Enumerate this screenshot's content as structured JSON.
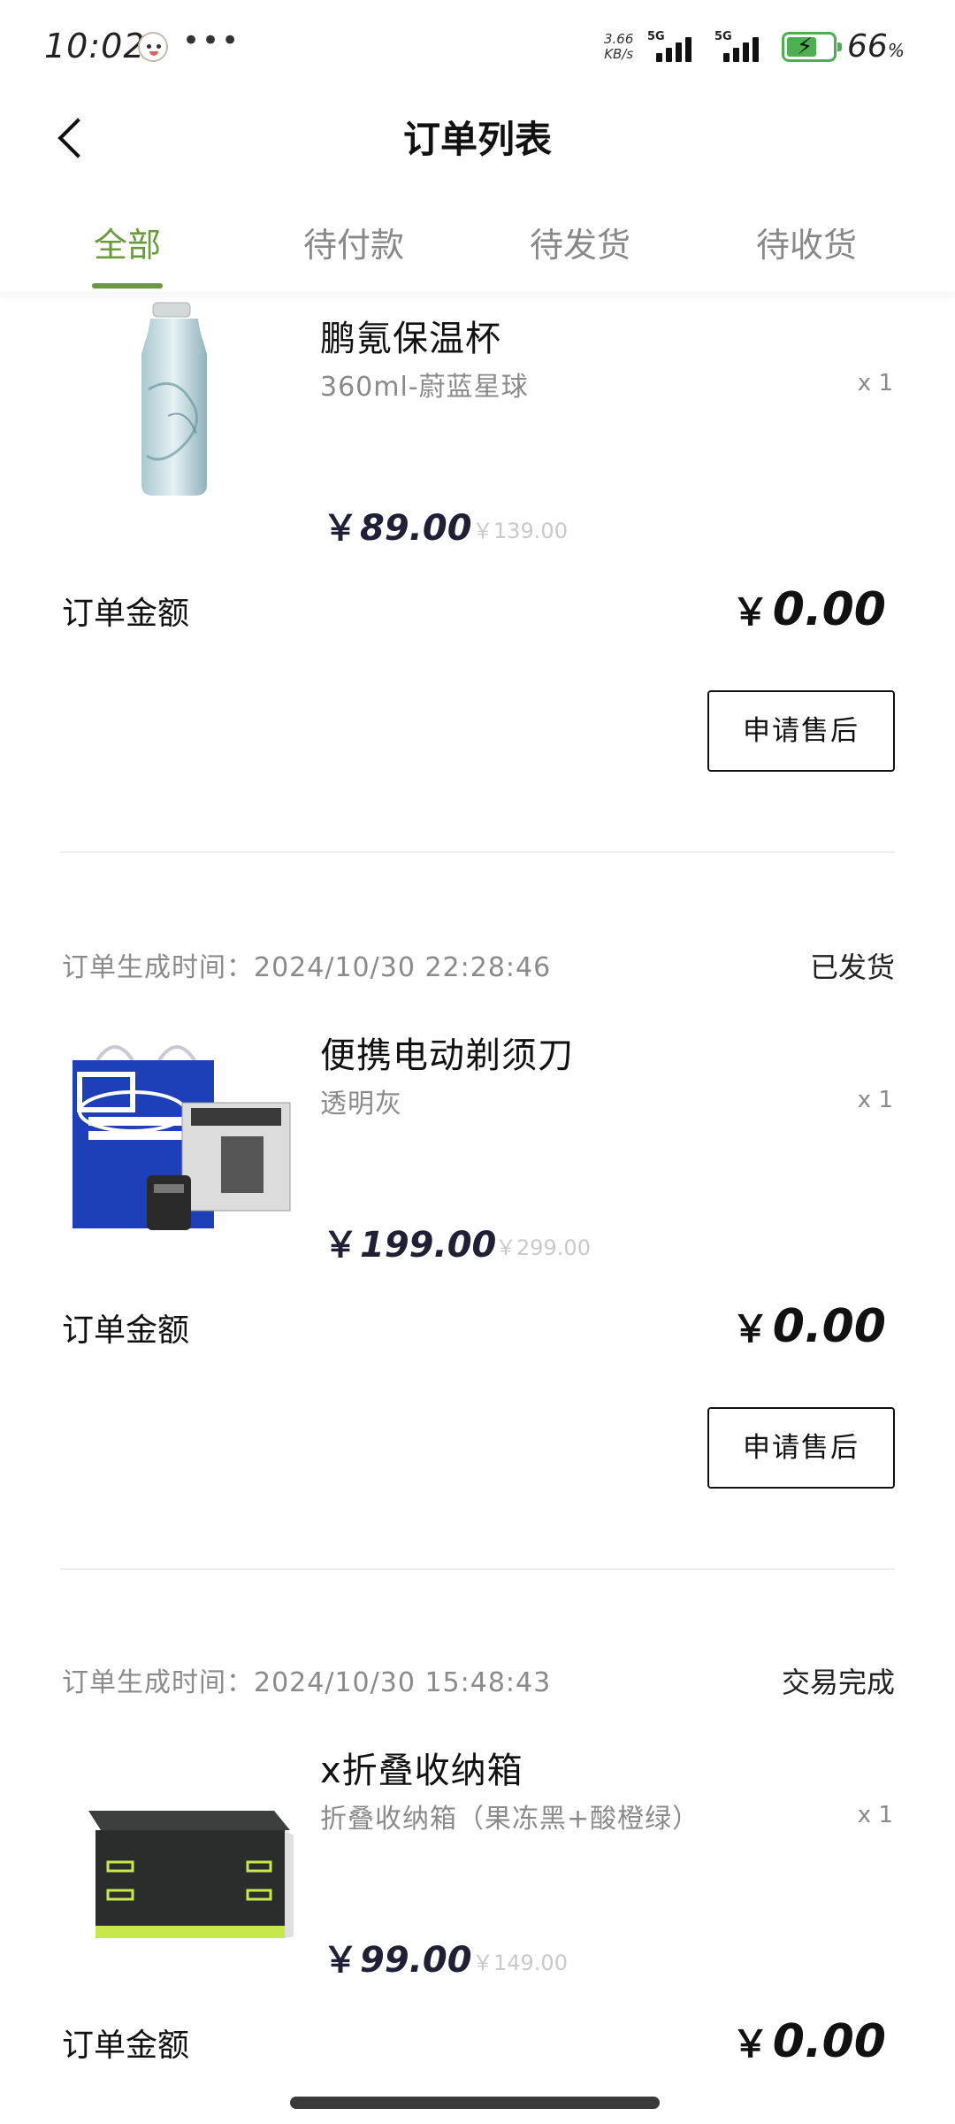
{
  "status_bar": {
    "time": "10:02",
    "dots": "•••",
    "speed_value": "3.66",
    "speed_unit": "KB/s",
    "sim1": "5G",
    "sim2": "5G",
    "battery": "66",
    "battery_unit": "%",
    "battery_color": "#4caf50"
  },
  "header": {
    "title": "订单列表",
    "back_icon": "chevron-left-icon"
  },
  "tabs": [
    {
      "label": "全部",
      "active": true
    },
    {
      "label": "待付款",
      "active": false
    },
    {
      "label": "待发货",
      "active": false
    },
    {
      "label": "待收货",
      "active": false
    }
  ],
  "accent_color": "#6a9a3a",
  "orders": [
    {
      "product_name": "鹏氪保温杯",
      "spec": "360ml-蔚蓝星球",
      "qty": "x 1",
      "currency": "￥",
      "price": "89.00",
      "original_price": "￥139.00",
      "amount_label": "订单金额",
      "amount": "0.00",
      "button": "申请售后"
    },
    {
      "time_label": "订单生成时间：",
      "time": "2024/10/30 22:28:46",
      "status": "已发货",
      "product_name": "便携电动剃须刀",
      "spec": "透明灰",
      "qty": "x 1",
      "currency": "￥",
      "price": "199.00",
      "original_price": "￥299.00",
      "amount_label": "订单金额",
      "amount": "0.00",
      "button": "申请售后"
    },
    {
      "time_label": "订单生成时间：",
      "time": "2024/10/30 15:48:43",
      "status": "交易完成",
      "product_name": "x折叠收纳箱",
      "spec": "折叠收纳箱（果冻黑+酸橙绿）",
      "qty": "x 1",
      "currency": "￥",
      "price": "99.00",
      "original_price": "￥149.00",
      "amount_label": "订单金额",
      "amount": "0.00"
    }
  ]
}
